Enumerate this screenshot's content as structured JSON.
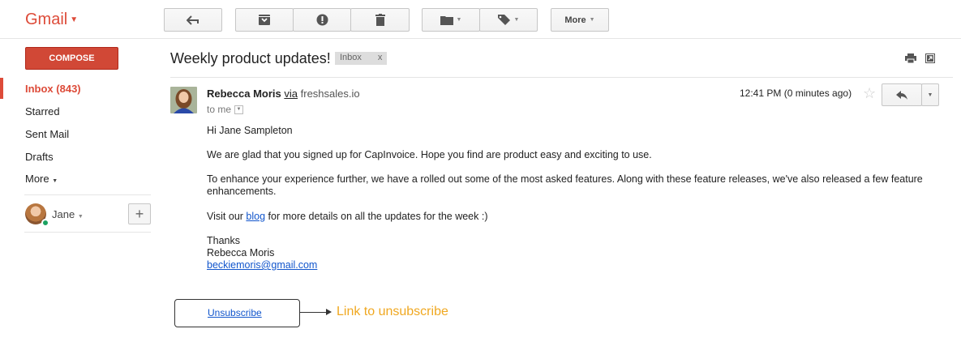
{
  "app": {
    "logo": "Gmail"
  },
  "toolbar": {
    "more_label": "More"
  },
  "sidebar": {
    "compose_label": "COMPOSE",
    "items": [
      {
        "label": "Inbox (843)",
        "active": true
      },
      {
        "label": "Starred"
      },
      {
        "label": "Sent Mail"
      },
      {
        "label": "Drafts"
      },
      {
        "label": "More"
      }
    ],
    "account": {
      "name": "Jane",
      "status_color": "#1ba261"
    }
  },
  "message": {
    "subject": "Weekly product updates!",
    "label_chip": {
      "name": "Inbox",
      "remove": "x"
    },
    "sender_name": "Rebecca Moris",
    "via": "via",
    "domain": "freshsales.io",
    "recipient": "to me",
    "timestamp": "12:41 PM (0 minutes ago)",
    "greeting": "Hi Jane Sampleton",
    "para1": "We are glad that you signed up for CapInvoice. Hope you find are product easy and exciting to use.",
    "para2": "To enhance your experience further, we have a rolled out some of the most asked features. Along with these feature releases, we've also released a few feature enhancements.",
    "para3_prefix": "Visit our ",
    "para3_link": "blog",
    "para3_suffix": " for more details on all the updates for the week :)",
    "signoff": "Thanks",
    "signature_name": "Rebecca Moris",
    "signature_email": "beckiemoris@gmail.com",
    "unsubscribe": "Unsubscribe"
  },
  "annotation": {
    "text": "Link to unsubscribe",
    "color": "#f0a821"
  },
  "colors": {
    "brand_red": "#dd4b39",
    "compose_red": "#d14836",
    "link_blue": "#1155cc"
  }
}
